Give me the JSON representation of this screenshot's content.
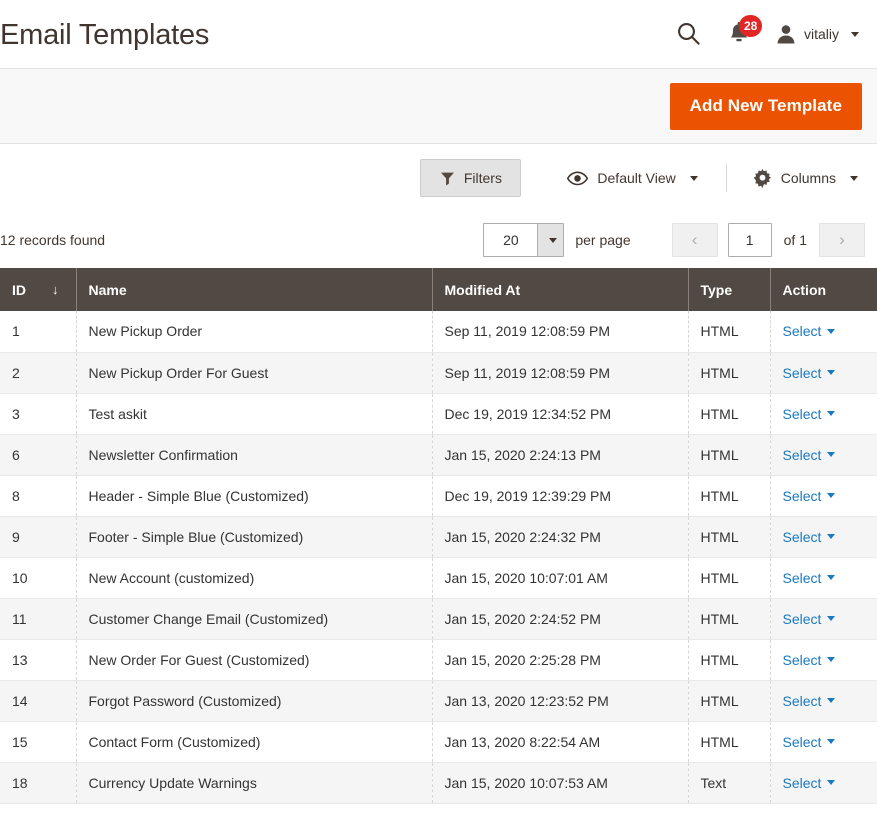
{
  "header": {
    "title": "Email Templates",
    "search_icon": "search-icon",
    "notifications": {
      "icon": "bell-icon",
      "count": "28"
    },
    "user": {
      "icon": "user-avatar-icon",
      "name": "vitaliy"
    }
  },
  "action_bar": {
    "add_new_label": "Add New Template",
    "accent_color": "#eb5202"
  },
  "toolbar": {
    "filters_label": "Filters",
    "filters_icon": "funnel-icon",
    "view_label": "Default View",
    "view_icon": "eye-icon",
    "columns_label": "Columns",
    "columns_icon": "gear-icon"
  },
  "paging": {
    "records_found": "12 records found",
    "per_page_value": "20",
    "per_page_label": "per page",
    "current_page": "1",
    "of_label": "of 1",
    "prev_glyph": "‹",
    "next_glyph": "›"
  },
  "table": {
    "columns": [
      {
        "key": "id",
        "label": "ID",
        "sorted": true,
        "sort_glyph": "↓"
      },
      {
        "key": "name",
        "label": "Name"
      },
      {
        "key": "modified_at",
        "label": "Modified At"
      },
      {
        "key": "type",
        "label": "Type"
      },
      {
        "key": "action",
        "label": "Action"
      }
    ],
    "action_label": "Select",
    "rows": [
      {
        "id": "1",
        "name": "New Pickup Order",
        "modified_at": "Sep 11, 2019 12:08:59 PM",
        "type": "HTML",
        "action": "Select"
      },
      {
        "id": "2",
        "name": "New Pickup Order For Guest",
        "modified_at": "Sep 11, 2019 12:08:59 PM",
        "type": "HTML",
        "action": "Select"
      },
      {
        "id": "3",
        "name": "Test askit",
        "modified_at": "Dec 19, 2019 12:34:52 PM",
        "type": "HTML",
        "action": "Select"
      },
      {
        "id": "6",
        "name": "Newsletter Confirmation",
        "modified_at": "Jan 15, 2020 2:24:13 PM",
        "type": "HTML",
        "action": "Select"
      },
      {
        "id": "8",
        "name": "Header - Simple Blue (Customized)",
        "modified_at": "Dec 19, 2019 12:39:29 PM",
        "type": "HTML",
        "action": "Select"
      },
      {
        "id": "9",
        "name": "Footer - Simple Blue (Customized)",
        "modified_at": "Jan 15, 2020 2:24:32 PM",
        "type": "HTML",
        "action": "Select"
      },
      {
        "id": "10",
        "name": "New Account (customized)",
        "modified_at": "Jan 15, 2020 10:07:01 AM",
        "type": "HTML",
        "action": "Select"
      },
      {
        "id": "11",
        "name": "Customer Change Email (Customized)",
        "modified_at": "Jan 15, 2020 2:24:52 PM",
        "type": "HTML",
        "action": "Select"
      },
      {
        "id": "13",
        "name": "New Order For Guest (Customized)",
        "modified_at": "Jan 15, 2020 2:25:28 PM",
        "type": "HTML",
        "action": "Select"
      },
      {
        "id": "14",
        "name": "Forgot Password (Customized)",
        "modified_at": "Jan 13, 2020 12:23:52 PM",
        "type": "HTML",
        "action": "Select"
      },
      {
        "id": "15",
        "name": "Contact Form (Customized)",
        "modified_at": "Jan 13, 2020 8:22:54 AM",
        "type": "HTML",
        "action": "Select"
      },
      {
        "id": "18",
        "name": "Currency Update Warnings",
        "modified_at": "Jan 15, 2020 10:07:53 AM",
        "type": "Text",
        "action": "Select"
      }
    ]
  }
}
